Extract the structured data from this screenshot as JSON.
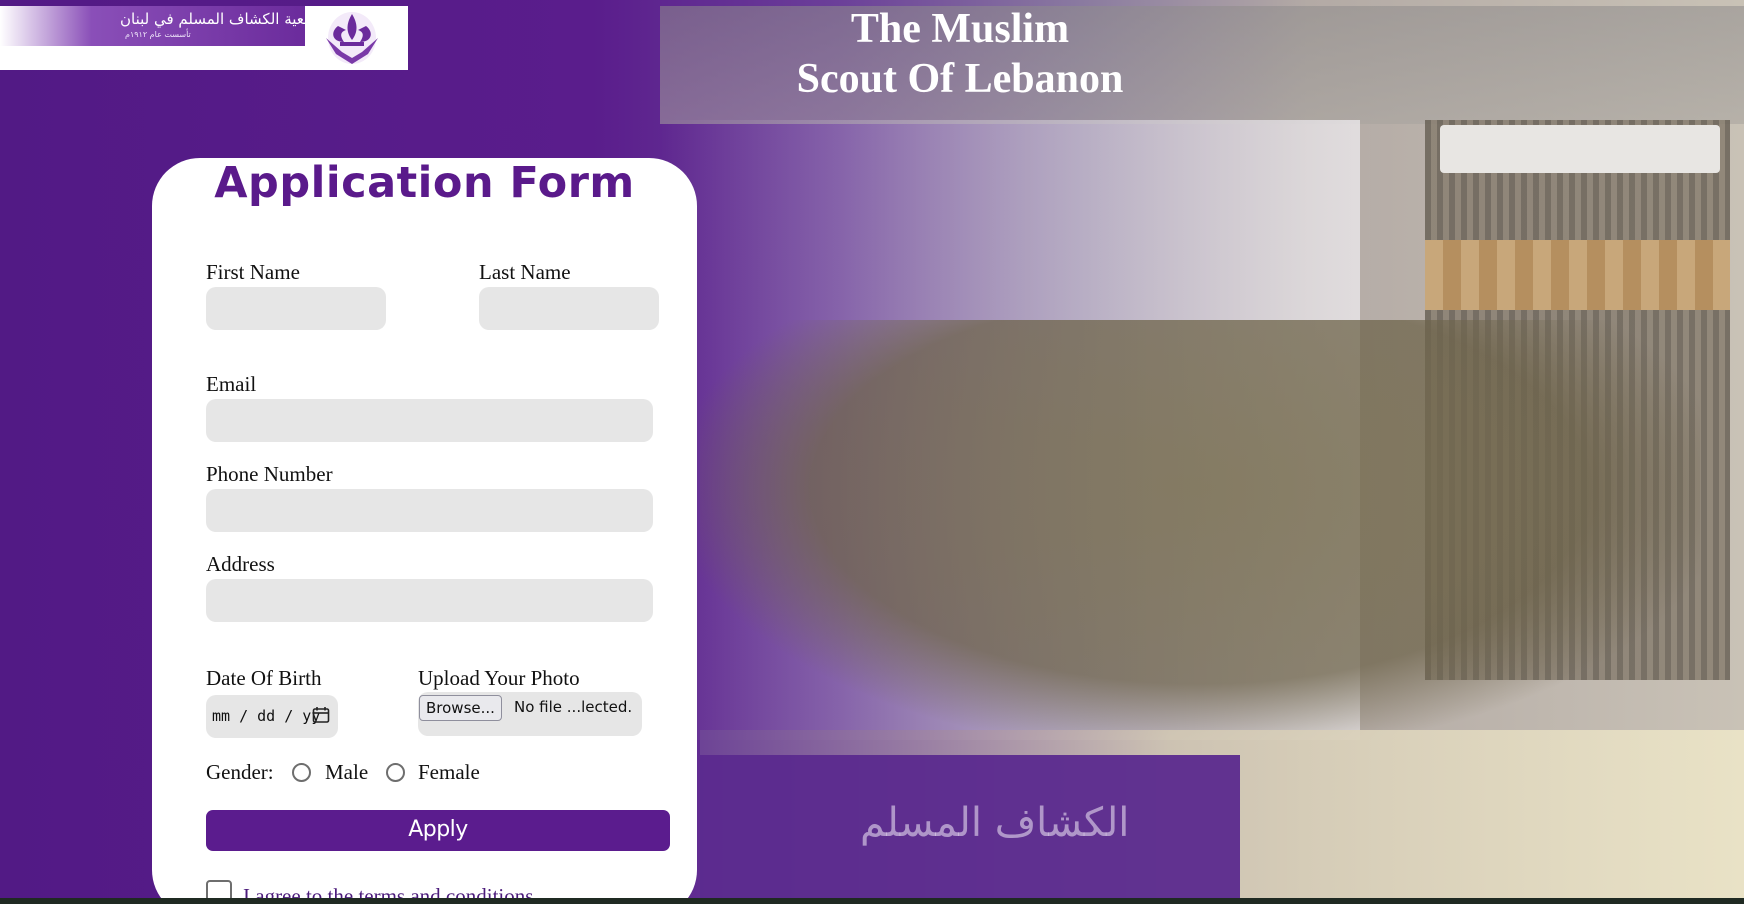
{
  "header": {
    "logo_arabic": "جمعية الكشاف المسلم في لبنان",
    "logo_subtitle": "تأسست عام ١٩١٢م",
    "title_line1": "The Muslim",
    "title_line2": "Scout Of Lebanon"
  },
  "background": {
    "banner_text": "الكشاف المسلم"
  },
  "form": {
    "title": "Application Form",
    "first_name_label": "First Name",
    "last_name_label": "Last Name",
    "email_label": "Email",
    "phone_label": "Phone Number",
    "address_label": "Address",
    "dob_label": "Date Of Birth",
    "dob_placeholder": "mm / dd / yy",
    "photo_label": "Upload Your Photo",
    "browse_label": "Browse...",
    "file_status": "No file ...lected.",
    "gender_label": "Gender:",
    "gender_options": [
      "Male",
      "Female"
    ],
    "apply_label": "Apply",
    "terms_label": "I agree to the terms and conditions"
  },
  "colors": {
    "brand_purple": "#5b1c8e",
    "field_gray": "#e6e6e6"
  }
}
